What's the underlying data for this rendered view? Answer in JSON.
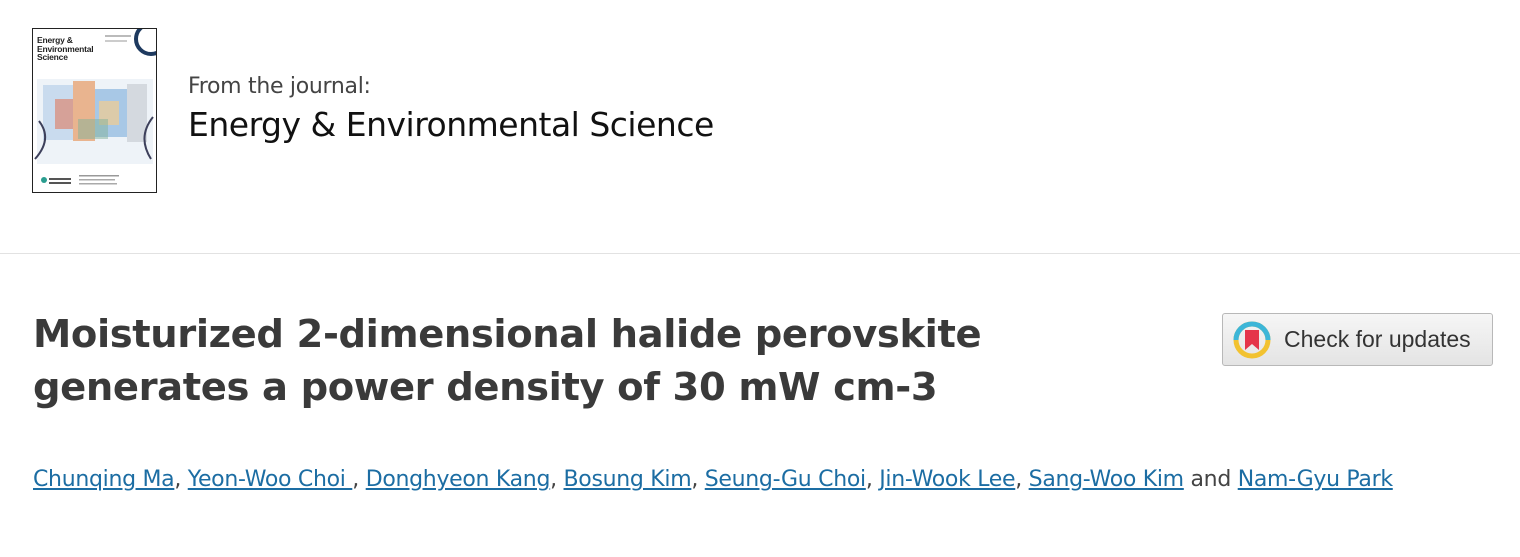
{
  "journal": {
    "from_label": "From the journal:",
    "name": "Energy & Environmental Science",
    "cover_title_line1": "Energy &",
    "cover_title_line2": "Environmental",
    "cover_title_line3": "Science"
  },
  "article": {
    "title_line1": "Moisturized 2-dimensional halide perovskite",
    "title_line2": "generates a power density of 30 mW cm-3"
  },
  "check_updates": {
    "label": "Check for updates",
    "icon": "crossmark-icon"
  },
  "authors": [
    {
      "name": "Chunqing Ma",
      "sep": ", "
    },
    {
      "name": "Yeon-Woo Choi ",
      "sep": ", "
    },
    {
      "name": "Donghyeon Kang",
      "sep": ", "
    },
    {
      "name": "Bosung Kim",
      "sep": ", "
    },
    {
      "name": "Seung-Gu Choi",
      "sep": ", "
    },
    {
      "name": "Jin-Wook Lee",
      "sep": ", "
    },
    {
      "name": "Sang-Woo Kim",
      "sep": " and "
    },
    {
      "name": "Nam-Gyu Park",
      "sep": ""
    }
  ],
  "colors": {
    "link": "#1c6da3",
    "title": "#3a3a3a",
    "divider": "#e2e2e2"
  }
}
